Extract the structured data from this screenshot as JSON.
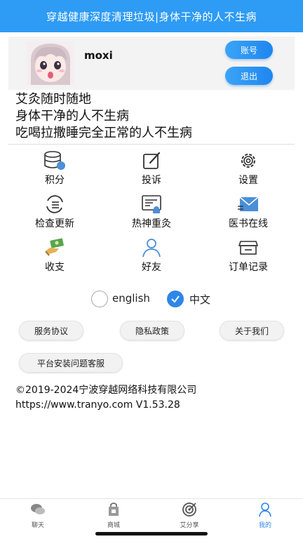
{
  "header": {
    "title": "穿越健康深度清理垃圾|身体干净的人不生病"
  },
  "profile": {
    "username": "moxi",
    "account_btn": "账号",
    "logout_btn": "退出"
  },
  "slogans": [
    "艾灸随时随地",
    "身体干净的人不生病",
    "吃喝拉撒睡完全正常的人不生病"
  ],
  "grid": {
    "points": "积分",
    "complaint": "投诉",
    "settings": "设置",
    "update": "检查更新",
    "moxibustion": "热神重灸",
    "medbook": "医书在线",
    "finance": "收支",
    "friends": "好友",
    "orders": "订单记录"
  },
  "language": {
    "english": "english",
    "chinese": "中文",
    "selected": "中文"
  },
  "links": {
    "service": "服务协议",
    "privacy": "隐私政策",
    "about": "关于我们",
    "support": "平台安装问题客服"
  },
  "footer": {
    "copyright": "©2019-2024宁波穿越网络科技有限公司",
    "url_version": "https://www.tranyo.com V1.53.28"
  },
  "tabs": {
    "chat": "聊天",
    "mall": "商城",
    "share": "艾分享",
    "mine": "我的",
    "active": "我的"
  },
  "colors": {
    "primary": "#2e9bf4",
    "accent": "#2e86e6"
  }
}
